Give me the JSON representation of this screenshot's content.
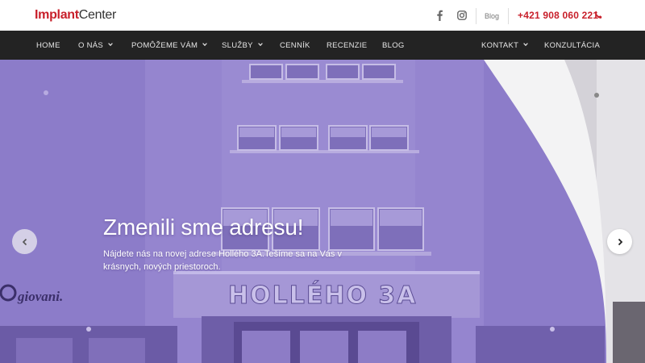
{
  "brand": {
    "logo_part1": "Implant",
    "logo_part2": "Center"
  },
  "topbar": {
    "social": [
      "facebook-icon",
      "instagram-icon"
    ],
    "blog_label": "Blog",
    "phone": "+421 908 060 221"
  },
  "nav": {
    "items": [
      {
        "label": "HOME",
        "dropdown": false
      },
      {
        "label": "O NÁS",
        "dropdown": true
      },
      {
        "label": "POMÔŽEME VÁM",
        "dropdown": true
      },
      {
        "label": "SLUŽBY",
        "dropdown": true
      },
      {
        "label": "CENNÍK",
        "dropdown": false
      },
      {
        "label": "RECENZIE",
        "dropdown": false
      },
      {
        "label": "BLOG",
        "dropdown": false
      },
      {
        "label": "KONTAKT",
        "dropdown": true
      },
      {
        "label": "KONZULTÁCIA",
        "dropdown": false
      }
    ]
  },
  "hero": {
    "headline": "Zmenili sme adresu!",
    "subtext": "Nájdete nás na novej adrese Hollého 3A.Tešíme sa na Vás v krásnych, nových priestoroch.",
    "building_sign": "HOLLÉHO 3A",
    "neighbor_sign": "giovani.",
    "overlay_color": "#8a79c6",
    "prev_icon": "chevron-left-icon",
    "next_icon": "chevron-right-icon"
  },
  "colors": {
    "accent": "#c8202b",
    "nav_bg": "#232323"
  }
}
